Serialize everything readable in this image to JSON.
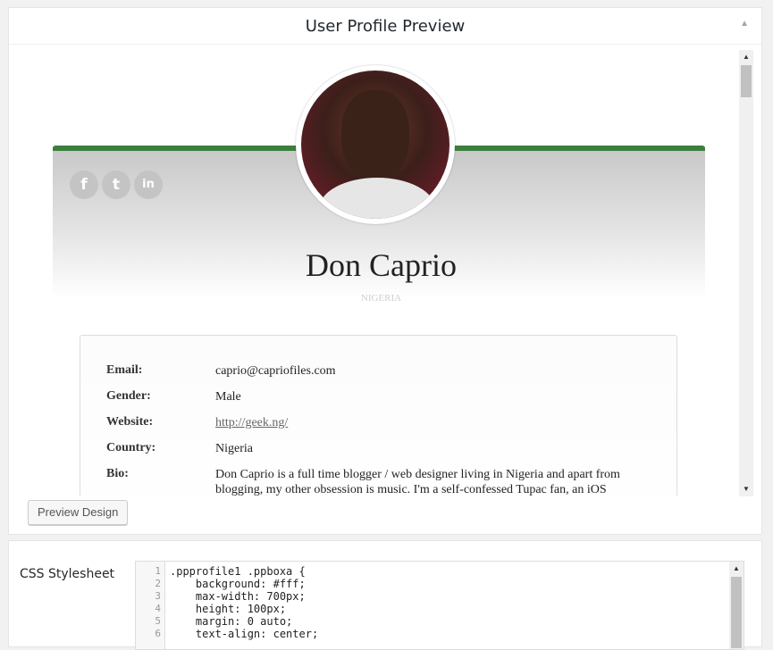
{
  "preview_panel": {
    "title": "User Profile Preview",
    "collapse_icon": "▲",
    "preview_button": "Preview Design"
  },
  "profile": {
    "name": "Don Caprio",
    "country": "NIGERIA",
    "social": [
      "facebook-icon",
      "twitter-icon",
      "linkedin-icon"
    ],
    "accent_color": "#3c7f3c",
    "details": [
      {
        "label": "Email:",
        "value": "caprio@capriofiles.com"
      },
      {
        "label": "Gender:",
        "value": "Male"
      },
      {
        "label": "Website:",
        "value": "http://geek.ng/"
      },
      {
        "label": "Country:",
        "value": "Nigeria"
      },
      {
        "label": "Bio:",
        "value": "Don Caprio is a full time blogger / web designer living in Nigeria and apart from blogging, my other obsession is music. I'm a self-confessed Tupac fan, an iOS"
      }
    ]
  },
  "css_panel": {
    "label": "CSS Stylesheet",
    "lines": [
      {
        "num": "1",
        "text": ".ppprofile1 .ppboxa {"
      },
      {
        "num": "2",
        "text": "    background: #fff;"
      },
      {
        "num": "3",
        "text": "    max-width: 700px;"
      },
      {
        "num": "4",
        "text": "    height: 100px;"
      },
      {
        "num": "5",
        "text": "    margin: 0 auto;"
      },
      {
        "num": "6",
        "text": "    text-align: center;"
      }
    ]
  }
}
